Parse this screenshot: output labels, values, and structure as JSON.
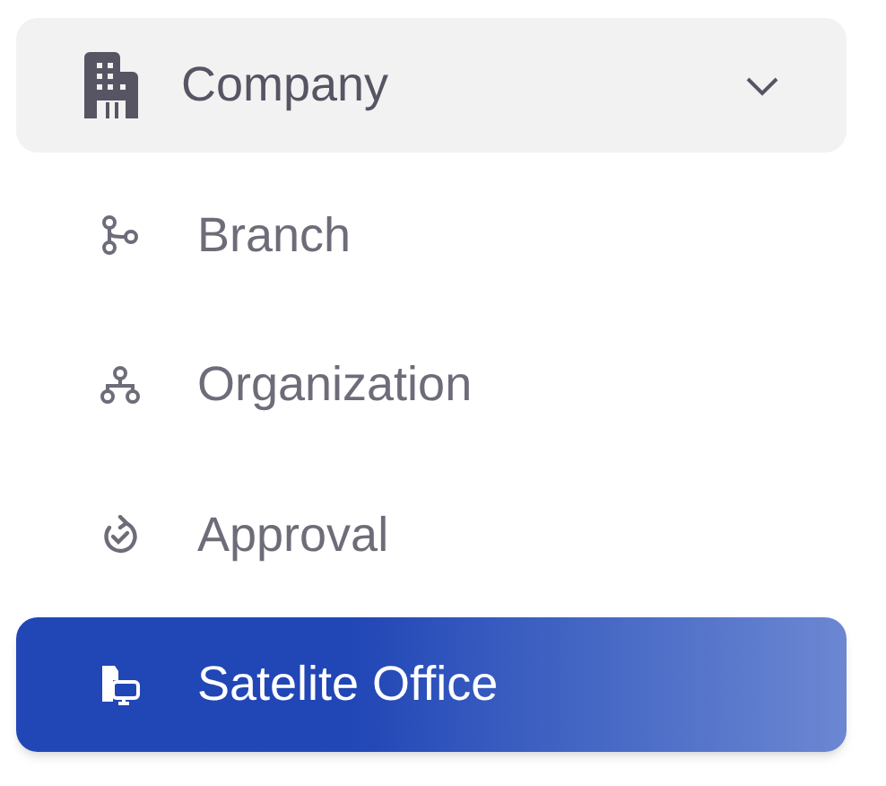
{
  "menu": {
    "label": "Company",
    "expanded": true,
    "children": [
      {
        "label": "Branch",
        "selected": false
      },
      {
        "label": "Organization",
        "selected": false
      },
      {
        "label": "Approval",
        "selected": false
      },
      {
        "label": "Satelite Office",
        "selected": true
      }
    ]
  }
}
